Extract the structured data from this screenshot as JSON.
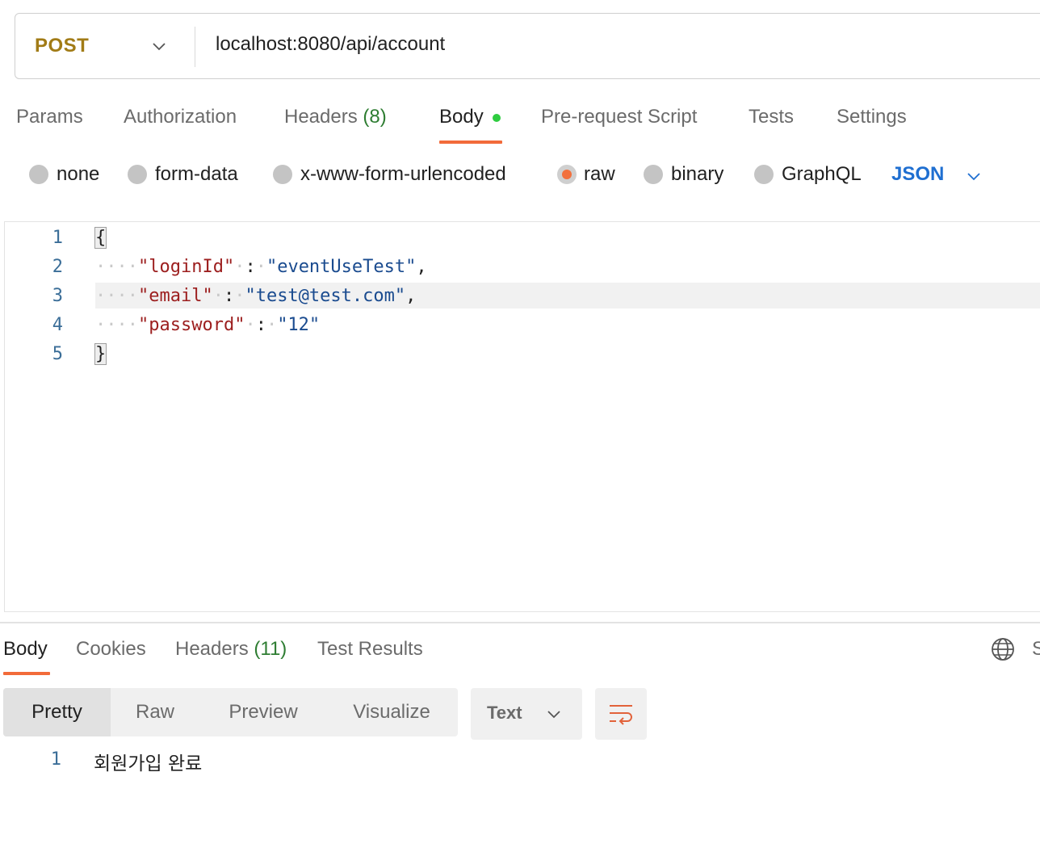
{
  "request": {
    "method": "POST",
    "url": "localhost:8080/api/account"
  },
  "request_tabs": {
    "params": "Params",
    "authorization": "Authorization",
    "headers": "Headers",
    "headers_count": "(8)",
    "body": "Body",
    "prerequest": "Pre-request Script",
    "tests": "Tests",
    "settings": "Settings"
  },
  "body_types": {
    "none": "none",
    "form_data": "form-data",
    "urlencoded": "x-www-form-urlencoded",
    "raw": "raw",
    "binary": "binary",
    "graphql": "GraphQL",
    "selected": "raw",
    "format": "JSON"
  },
  "editor": {
    "line_numbers": [
      "1",
      "2",
      "3",
      "4",
      "5"
    ],
    "open_brace": "{",
    "close_brace": "}",
    "lines": [
      {
        "key": "\"loginId\"",
        "value": "\"eventUseTest\"",
        "trailing": ","
      },
      {
        "key": "\"email\"",
        "value": "\"test@test.com\"",
        "trailing": ","
      },
      {
        "key": "\"password\"",
        "value": "\"12\"",
        "trailing": ""
      }
    ]
  },
  "response_tabs": {
    "body": "Body",
    "cookies": "Cookies",
    "headers": "Headers",
    "headers_count": "(11)",
    "test_results": "Test Results",
    "cut_text": "S"
  },
  "view_modes": {
    "pretty": "Pretty",
    "raw": "Raw",
    "preview": "Preview",
    "visualize": "Visualize",
    "format": "Text"
  },
  "response": {
    "line_number": "1",
    "text": "회원가입 완료"
  },
  "colors": {
    "accent": "#f26b3a",
    "method": "#a17b16",
    "json": "#1f6fd1",
    "count": "#2e7d32"
  }
}
